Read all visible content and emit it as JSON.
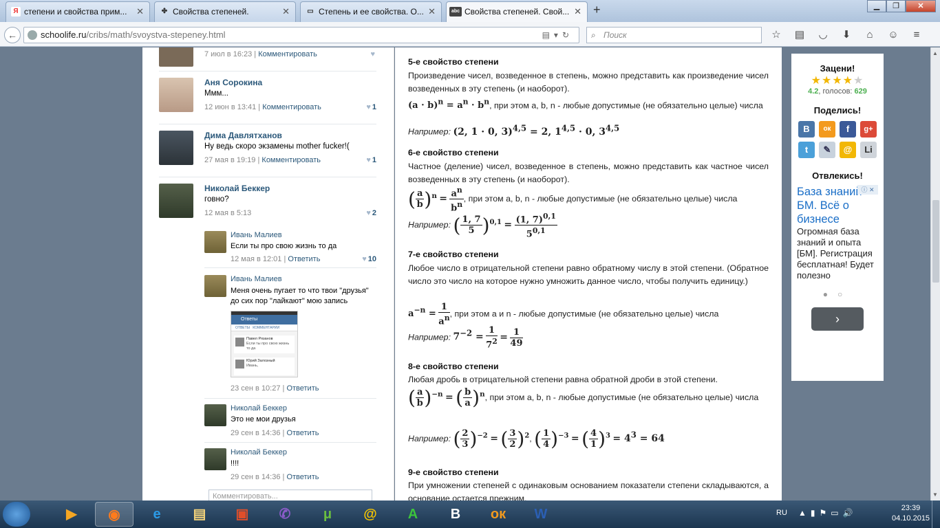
{
  "browser": {
    "tabs": [
      {
        "favicon": "Я",
        "title": "степени и свойства прим..."
      },
      {
        "favicon": "✤",
        "title": "Свойства степеней."
      },
      {
        "favicon": "▭",
        "title": "Степень и ее свойства. О..."
      },
      {
        "favicon": "abc",
        "title": "Свойства степеней. Свой..."
      }
    ],
    "new_tab": "+",
    "url_domain": "schoolife.ru",
    "url_path": "/cribs/math/svoystva-stepeney.html",
    "search_placeholder": "Поиск"
  },
  "comments": {
    "c0": {
      "date": "7 июл в 16:23",
      "reply": "Комментировать"
    },
    "c1": {
      "name": "Аня Сорокина",
      "text": "Ммм...",
      "date": "12 июн в 13:41",
      "reply": "Комментировать",
      "likes": "1"
    },
    "c2": {
      "name": "Дима Давлятханов",
      "text": "Ну ведь скоро экзамены mother fucker!(",
      "date": "27 мая в 19:19",
      "reply": "Комментировать",
      "likes": "1"
    },
    "c3": {
      "name": "Николай Беккер",
      "text": "говно?",
      "date": "12 мая в 5:13",
      "likes": "2"
    },
    "r1": {
      "name": "Ивань Малиев",
      "text": "Если ты про свою жизнь то да",
      "date": "12 мая в 12:01",
      "reply": "Ответить",
      "likes": "10"
    },
    "r2": {
      "name": "Ивань Малиев",
      "text": "Меня очень пугает то что твои \"друзья\" до сих пор \"лайкают\" мою запись",
      "date": "23 сен в 10:27",
      "reply": "Ответить",
      "shot": {
        "header": "Ответы",
        "tab": "ОТВЕТЫ",
        "tab2": "КОММЕНТАРИИ",
        "n1": "Павел Рязанов",
        "t1": "Если ты про свою жизнь то да",
        "n2": "Юрий Залозный",
        "t2": "Ивань,"
      }
    },
    "r3": {
      "name": "Николай Беккер",
      "text": "Это не мои друзья",
      "date": "29 сен в 14:36",
      "reply": "Ответить"
    },
    "r4": {
      "name": "Николай Беккер",
      "text": "!!!!",
      "date": "29 сен в 14:36",
      "reply": "Ответить"
    },
    "input_placeholder": "Комментировать..."
  },
  "article": {
    "p5": {
      "heading": "5-е свойство степени",
      "text": "Произведение чисел, возведенное в степень, можно представить как произведение чисел возведенных в эту степень (и наоборот).",
      "rule": "при этом a, b, n - любые допустимые (не обязательно целые) числа",
      "example_label": "Например:"
    },
    "p6": {
      "heading": "6-е свойство степени",
      "text": "Частное (деление) чисел, возведенное в степень, можно представить как частное чисел возведенных в эту степень (и наоборот).",
      "rule": ", при этом a, b, n - любые допустимые (не обязательно целые) числа",
      "example_label": "Например:"
    },
    "p7": {
      "heading": "7-е свойство степени",
      "text": "Любое число в отрицательной степени равно обратному числу в этой степени. (Обратное число это число на которое нужно умножить данное число, чтобы получить единицу.)",
      "rule": ", при этом a и n - любые допустимые (не обязательно целые) числа",
      "example_label": "Например:"
    },
    "p8": {
      "heading": "8-е свойство степени",
      "text": "Любая дробь в отрицательной степени равна обратной дроби в этой степени.",
      "rule": ", при этом a, b, n - любые допустимые (не обязательно целые) числа",
      "example_label": "Например:"
    },
    "p9": {
      "heading": "9-е свойство степени",
      "text": "При умножении степеней с одинаковым основанием показатели степени складываются, а основание остается прежним."
    }
  },
  "widget": {
    "rate_title": "Зацени!",
    "rating": "4.2",
    "votes_label": ", голосов:",
    "votes": "629",
    "share_title": "Поделись!",
    "share_icons": [
      "В",
      "ок",
      "f",
      "g+",
      "t",
      "✎",
      "@",
      "Li"
    ],
    "break_title": "Отвлекись!",
    "ad_title": "База знаний БМ. Всё о бизнесе",
    "ad_text": "Огромная база знаний и опыта [БМ]. Регистрация бесплатная! Будет полезно",
    "ad_next": "›"
  },
  "taskbar": {
    "lang": "RU",
    "time": "23:39",
    "date": "04.10.2015"
  }
}
